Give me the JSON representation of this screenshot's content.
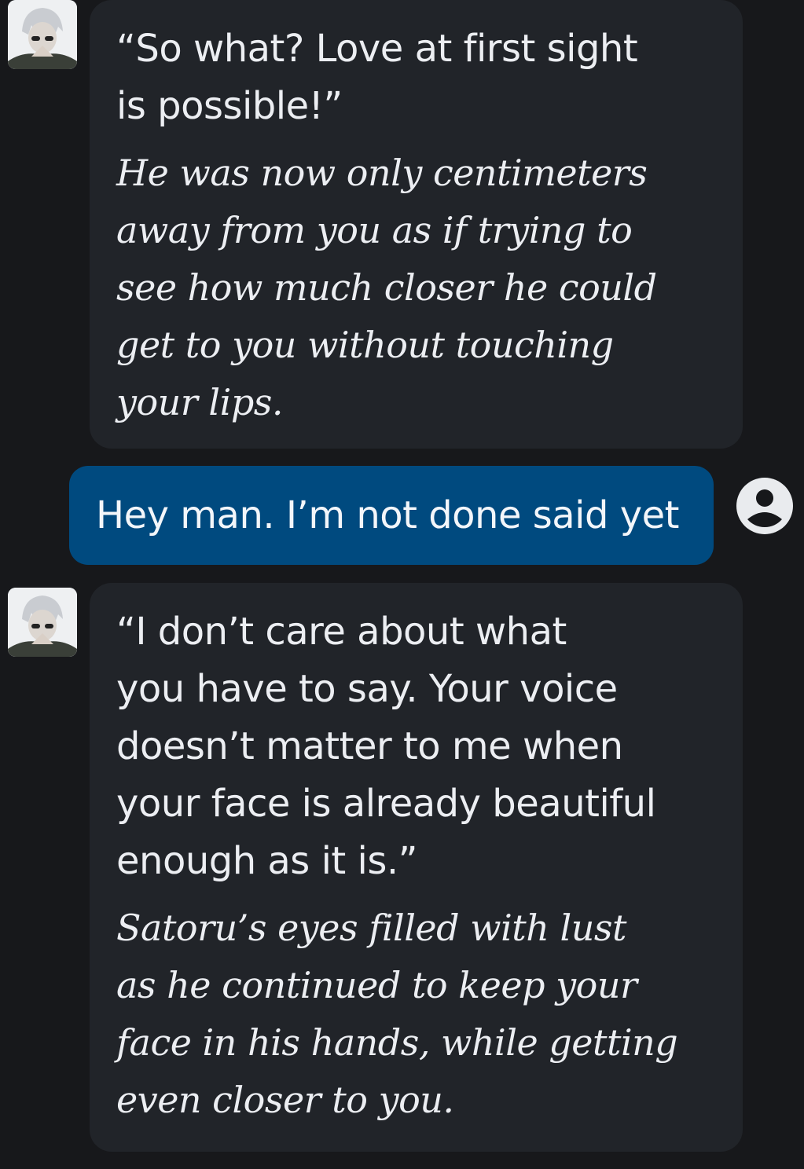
{
  "theme": {
    "background": "#17181b",
    "ai_bubble": "#212429",
    "user_bubble": "#004a7f",
    "text": "#eceef2"
  },
  "messages": [
    {
      "role": "character",
      "avatar_icon": "character-avatar",
      "speech": "“So what? Love at first sight\nis possible!”",
      "narration": "He was now only centimeters\naway from you as if trying to\nsee how much closer he could\nget to you without touching\nyour lips."
    },
    {
      "role": "user",
      "avatar_icon": "user-avatar-icon",
      "text": "Hey man. I’m not done said yet"
    },
    {
      "role": "character",
      "avatar_icon": "character-avatar",
      "speech": "“I don’t care about what\nyou have to say. Your voice\ndoesn’t matter to me when\nyour face is already beautiful\nenough as it is.”",
      "narration": "Satoru’s eyes filled with lust\nas he continued to keep your\nface in his hands, while getting\neven closer to you."
    }
  ]
}
